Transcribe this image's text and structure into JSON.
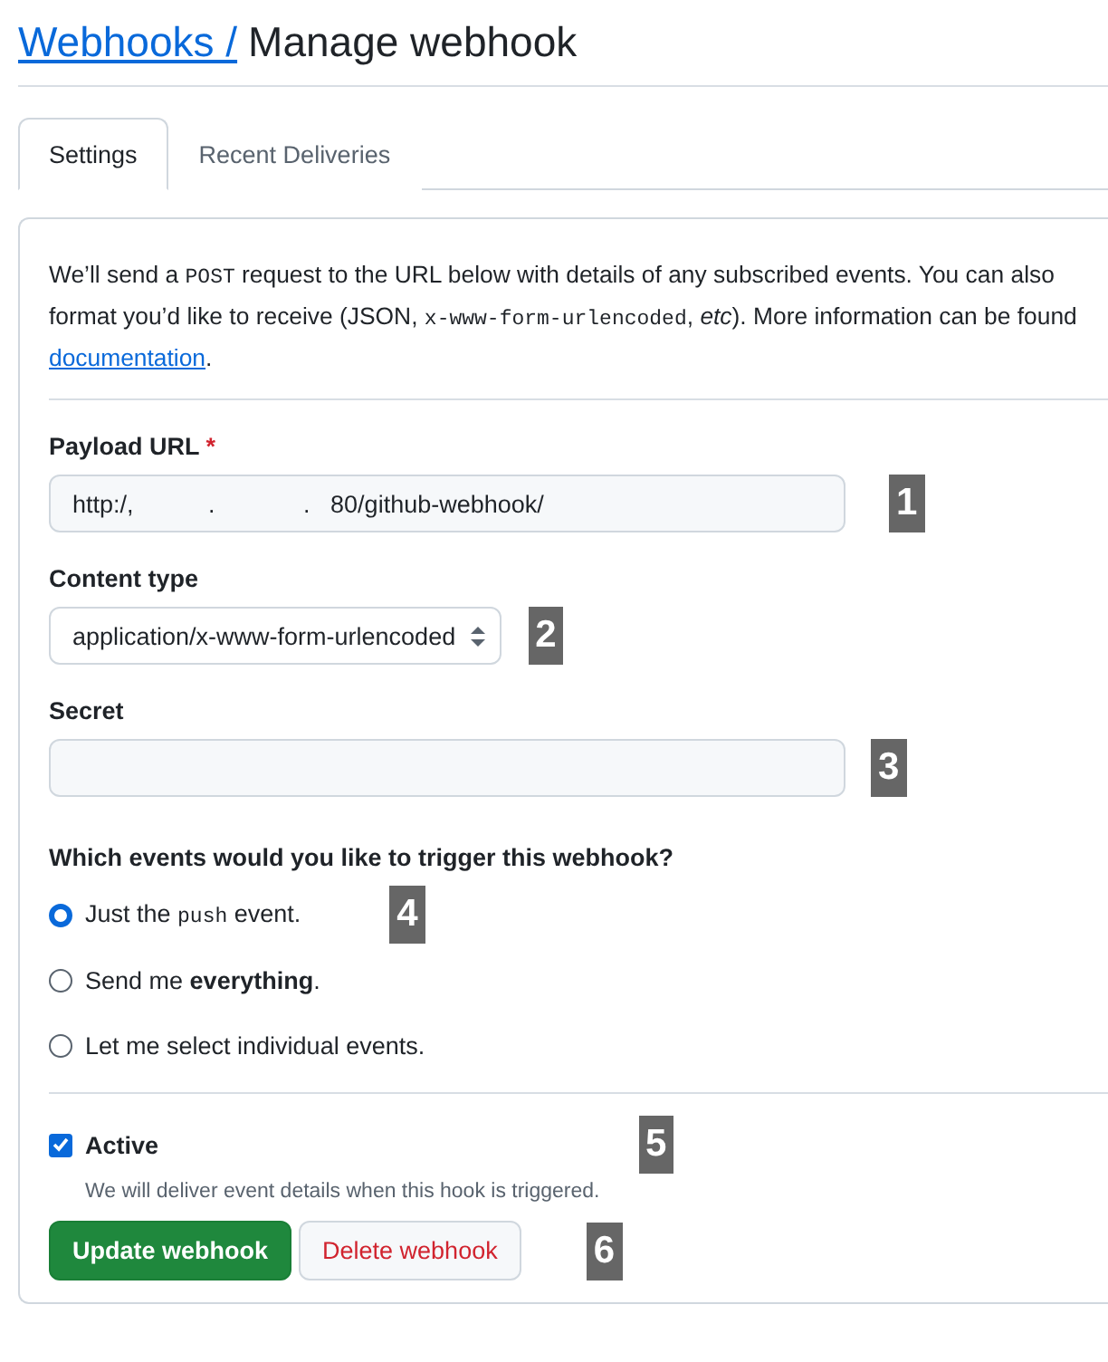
{
  "breadcrumb": {
    "parent": "Webhooks /",
    "current": "Manage webhook"
  },
  "tabs": [
    {
      "label": "Settings",
      "selected": true
    },
    {
      "label": "Recent Deliveries",
      "selected": false
    }
  ],
  "intro": [
    {
      "kind": "text",
      "text": "We’ll send a "
    },
    {
      "kind": "code",
      "text": "POST"
    },
    {
      "kind": "text",
      "text": " request to the URL below with details of any subscribed events. You can also"
    },
    {
      "kind": "break"
    },
    {
      "kind": "text",
      "text": "format you’d like to receive (JSON, "
    },
    {
      "kind": "code",
      "text": "x-www-form-urlencoded"
    },
    {
      "kind": "text",
      "text": ", "
    },
    {
      "kind": "italic",
      "text": "etc"
    },
    {
      "kind": "text",
      "text": "). More information can be found"
    },
    {
      "kind": "break"
    },
    {
      "kind": "link",
      "text": "documentation"
    },
    {
      "kind": "text",
      "text": "."
    }
  ],
  "payload_url": {
    "label": "Payload URL",
    "required_mark": "*",
    "value": "http:/,           .             .   80/github-webhook/"
  },
  "content_type": {
    "label": "Content type",
    "value": "application/x-www-form-urlencoded"
  },
  "secret": {
    "label": "Secret"
  },
  "events": {
    "question": "Which events would you like to trigger this webhook?",
    "options": [
      {
        "parts": [
          {
            "kind": "text",
            "text": "Just the "
          },
          {
            "kind": "code",
            "text": "push"
          },
          {
            "kind": "text",
            "text": " event."
          }
        ],
        "selected": true
      },
      {
        "parts": [
          {
            "kind": "text",
            "text": "Send me "
          },
          {
            "kind": "bold",
            "text": "everything"
          },
          {
            "kind": "text",
            "text": "."
          }
        ],
        "selected": false
      },
      {
        "parts": [
          {
            "kind": "text",
            "text": "Let me select individual events."
          }
        ],
        "selected": false
      }
    ]
  },
  "active": {
    "label": "Active",
    "checked": true,
    "note": "We will deliver event details when this hook is triggered."
  },
  "buttons": [
    {
      "label": "Update webhook",
      "kind": "primary"
    },
    {
      "label": "Delete webhook",
      "kind": "danger"
    }
  ],
  "annotations": [
    "1",
    "2",
    "3",
    "4",
    "5",
    "6"
  ]
}
